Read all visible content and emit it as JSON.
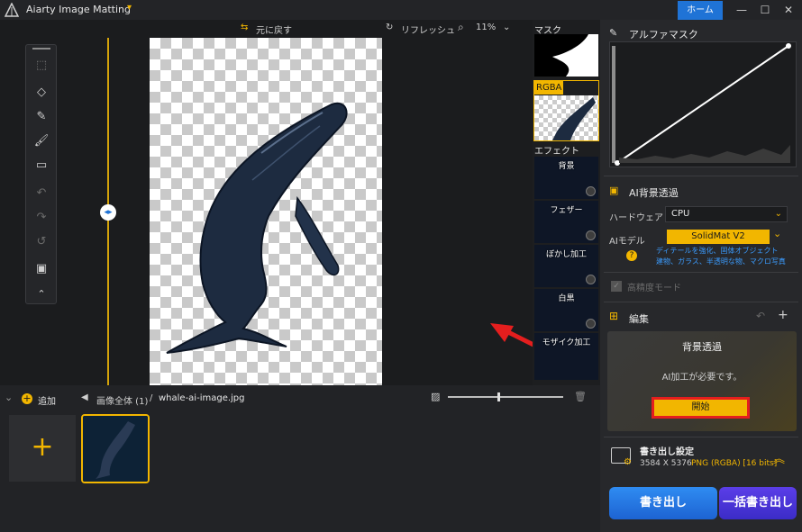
{
  "titlebar": {
    "app_title": "Aiarty Image Matting",
    "home_label": "ホーム",
    "minimize": "—",
    "maximize": "☐",
    "close": "✕"
  },
  "canvas_toolbar": {
    "undo_original": "元に戻す",
    "refresh": "リフレッシュ",
    "zoom": "11%"
  },
  "thumbnails": {
    "mask_label": "マスク",
    "rgba_label": "RGBA",
    "effect_label": "エフェクト",
    "effects": [
      "背景",
      "フェザー",
      "ぼかし加工",
      "白黒",
      "モザイク加工"
    ]
  },
  "right_panel": {
    "alpha_mask_title": "アルファマスク",
    "ai_bg_title": "AI背景透過",
    "hardware_label": "ハードウェア",
    "hardware_value": "CPU",
    "ai_model_label": "AIモデル",
    "ai_model_value": "SolidMat  V2",
    "model_desc_line1": "ディテールを強化、固体オブジェクト",
    "model_desc_line2": "建物、ガラス、半透明な物、マクロ写真",
    "high_precision_label": "高精度モード",
    "edit_title": "編集",
    "card_title": "背景透過",
    "card_message": "AI加工が必要です。",
    "start_label": "開始",
    "export_settings_title": "書き出し設定",
    "export_size": "3584 X 5376",
    "export_format": "PNG (RGBA) [16 bits]",
    "export_label": "書き出し",
    "batch_export_label": "一括書き出し"
  },
  "bottom": {
    "add_label": "追加",
    "breadcrumb_all": "画像全体 (1)",
    "breadcrumb_sep": "/",
    "file_name": "whale-ai-image.jpg",
    "zoom_fraction": 0.43
  },
  "colors": {
    "accent": "#f2b600",
    "blue": "#1f73d6",
    "highlight_red": "#e41e1e"
  }
}
